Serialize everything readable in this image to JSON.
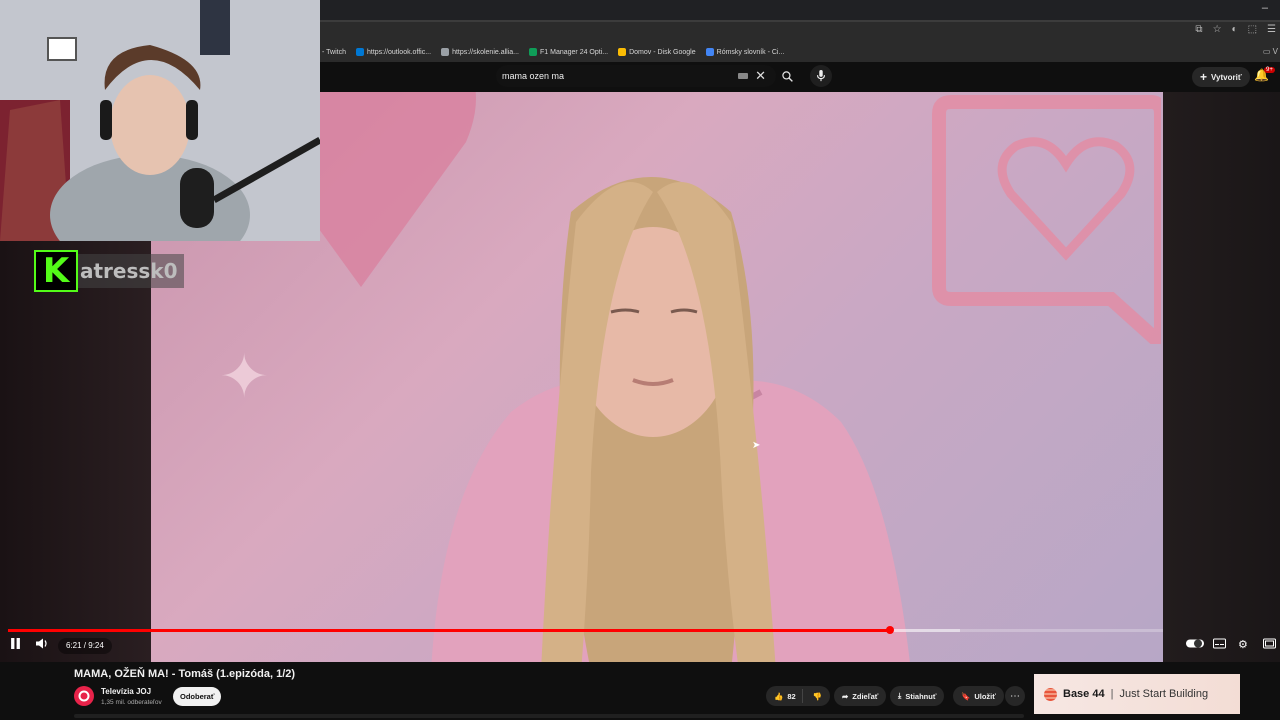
{
  "browser": {
    "bookmarks": [
      {
        "label": "- Twitch",
        "color": "#9146ff"
      },
      {
        "label": "https://outlook.offic...",
        "color": "#0078d4"
      },
      {
        "label": "https://skolenie.allia...",
        "color": "#9aa0a6"
      },
      {
        "label": "F1 Manager 24 Opti...",
        "color": "#0f9d58"
      },
      {
        "label": "Domov - Disk Google",
        "color": "#fbbc04"
      },
      {
        "label": "Rómsky slovník - Ci...",
        "color": "#4285f4"
      }
    ],
    "bookmarks_overflow": "V"
  },
  "youtube": {
    "search_query": "mama ozen ma",
    "create_label": "Vytvoriť",
    "notification_badge": "9+"
  },
  "player": {
    "current_time": "6:21",
    "duration": "9:24",
    "time_display": "6:21 / 9:24",
    "progress_fraction": 0.764,
    "buffered_fraction": 0.824
  },
  "stream_overlay": {
    "kick_logo": "K",
    "streamer_name": "atressk0",
    "accent_color": "#53fc18"
  },
  "video_info": {
    "title": "MAMA, OŽEŇ MA! - Tomáš (1.epizóda, 1/2)",
    "channel_name": "Televízia JOJ",
    "subscriber_count": "1,35 mil. odberateľov",
    "subscribe_label": "Odoberať",
    "like_count": "82",
    "share_label": "Zdieľať",
    "download_label": "Stiahnuť",
    "save_label": "Uložiť"
  },
  "ad": {
    "brand": "Base 44",
    "separator": "|",
    "tagline": "Just Start Building"
  },
  "colors": {
    "youtube_red": "#ff0000",
    "background": "#0f0f0f",
    "pill_bg": "#272727"
  }
}
